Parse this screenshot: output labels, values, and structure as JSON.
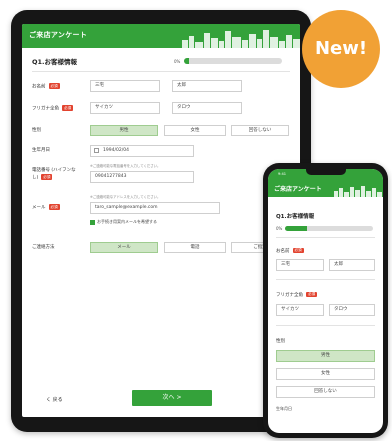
{
  "badge": {
    "label": "New!"
  },
  "tablet": {
    "header_title": "ご来店アンケート",
    "section_title": "Q1.お客様情報",
    "progress_text": "0%",
    "progress_value": 0.05,
    "fields": {
      "name": {
        "label": "お名前",
        "required": "必須",
        "last": "三宅",
        "first": "太郎"
      },
      "kana": {
        "label": "フリガナ全角",
        "required": "必須",
        "last": "サイカツ",
        "first": "タロウ"
      },
      "gender": {
        "label": "性別",
        "options": [
          "男性",
          "女性",
          "回答しない"
        ],
        "selected": 0
      },
      "birthday": {
        "label": "生年月日",
        "value": "1994/02/04"
      },
      "phone": {
        "label": "電話番号 (ハイフンなし)",
        "required": "必須",
        "hint": "※ご連絡可能な電話番号を入力してください。",
        "value": "09041277843"
      },
      "email": {
        "label": "メール",
        "required": "必須",
        "hint": "※ご連絡可能なアドレスを入力してください。",
        "value": "taro_sample@example.com",
        "checkbox_label": "お手続き用案内メールを希望する"
      },
      "contact": {
        "label": "ご連絡方法",
        "options": [
          "メール",
          "電話",
          "ご指定"
        ],
        "selected": 0
      }
    },
    "back_label": "く 戻る",
    "next_label": "次へ >"
  },
  "phone": {
    "status_time": "9:41",
    "header_title": "ご来店アンケート",
    "section_title": "Q1.お客様情報",
    "progress_text": "0%",
    "progress_value": 0.25,
    "name_label": "お名前",
    "name_required": "必須",
    "name_last": "三宅",
    "name_first": "太郎",
    "kana_label": "フリガナ全角",
    "kana_required": "必須",
    "kana_last": "サイカツ",
    "kana_first": "タロウ",
    "gender_label": "性別",
    "gender_options": [
      "男性",
      "女性",
      "回答しない"
    ],
    "gender_selected": 0,
    "birthday_label": "生年月日"
  },
  "colors": {
    "brand_green": "#34a23a",
    "badge_orange": "#f1a135",
    "required_red": "#e2432f"
  }
}
